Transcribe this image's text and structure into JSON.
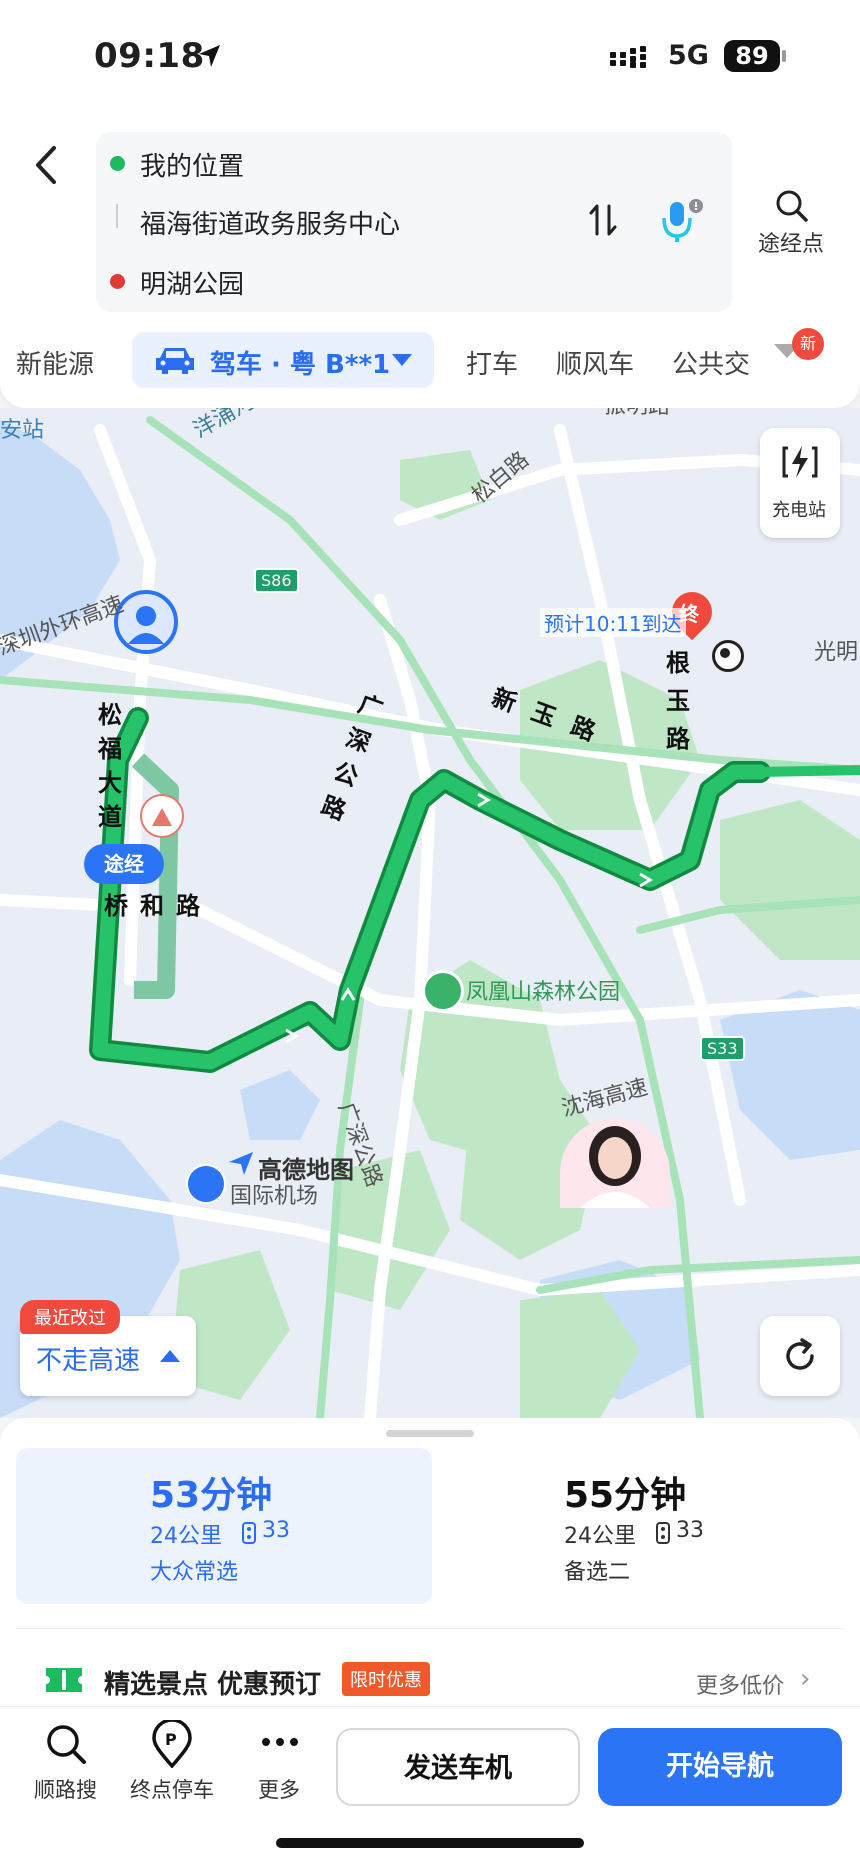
{
  "status": {
    "time": "09:18",
    "network": "5G",
    "battery": "89"
  },
  "header": {
    "origin": "我的位置",
    "waypoint": "福海街道政务服务中心",
    "destination": "明湖公园",
    "add_waypoint_label": "途经点"
  },
  "tabs": {
    "new_energy": "新能源",
    "drive": "驾车 · 粤 B**1",
    "taxi": "打车",
    "carpool": "顺风车",
    "transit": "公共交",
    "new_badge": "新"
  },
  "map": {
    "labels": {
      "yangyong_river": "洋涌河",
      "zhenming_road": "振明路",
      "songbai_road": "松白路",
      "station": "安站",
      "outer_ring": "深圳外环高速",
      "s86": "S86",
      "s33": "S33",
      "guangming": "光明",
      "songfu": "松福大道",
      "qiaohe": "桥和路",
      "guangshen": "广深公路",
      "xinyu": "新玉路",
      "genyu": "根玉路",
      "fenghuang_park": "凤凰山森林公园",
      "shenhai": "沈海高速",
      "airport": "国际机场",
      "guangshen2": "广深公路",
      "eta": "预计10:11到达",
      "end_marker": "终",
      "via_marker": "途经",
      "brand": "高德地图"
    },
    "charge_label": "充电站",
    "avoid_tag": "最近改过",
    "avoid_label": "不走高速"
  },
  "routes": [
    {
      "time": "53分钟",
      "distance": "24公里",
      "lights": "33",
      "note": "大众常选"
    },
    {
      "time": "55分钟",
      "distance": "24公里",
      "lights": "33",
      "note": "备选二"
    }
  ],
  "promo": {
    "text": "精选景点 优惠预订",
    "badge": "限时优惠",
    "more": "更多低价"
  },
  "nav": {
    "search_along": "顺路搜",
    "parking": "终点停车",
    "more": "更多",
    "send_to_car": "发送车机",
    "start_navigation": "开始导航"
  },
  "colors": {
    "accent": "#2a74f5",
    "route": "#1dbb60",
    "badge_red": "#f04a3f"
  }
}
